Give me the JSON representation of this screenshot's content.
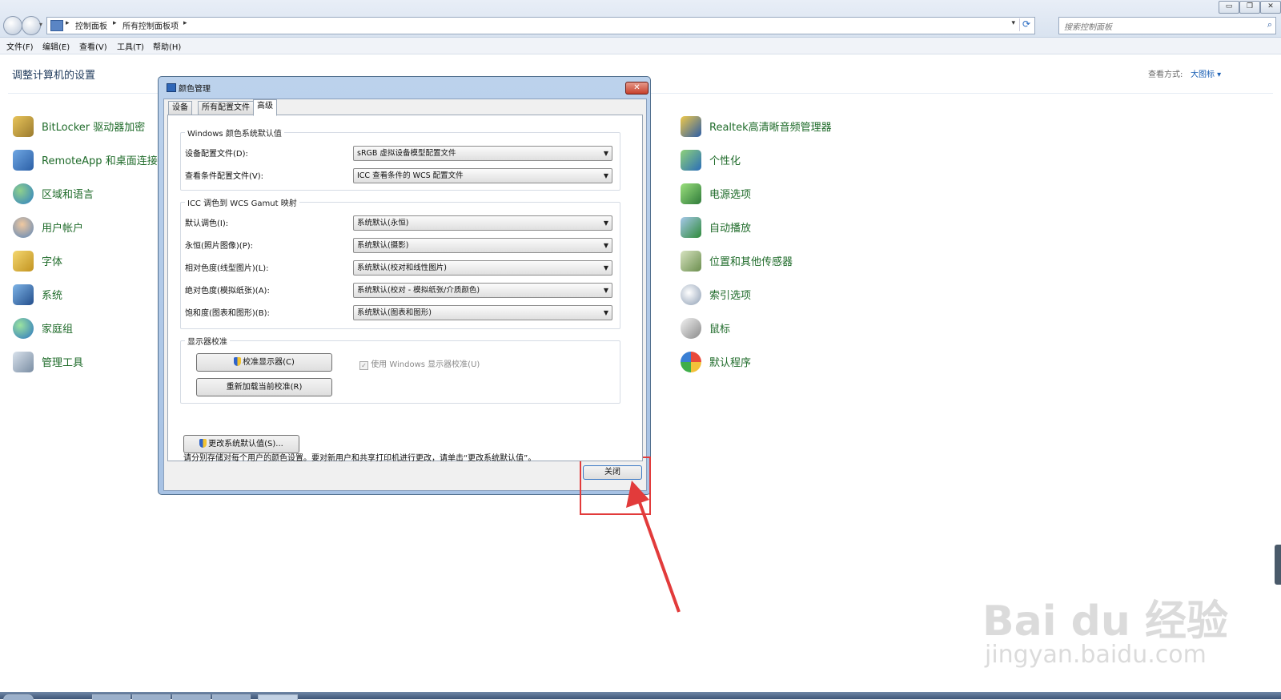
{
  "window": {
    "breadcrumbs": [
      "控制面板",
      "所有控制面板项"
    ],
    "search_placeholder": "搜索控制面板",
    "controls": [
      "▭",
      "❐",
      "✕"
    ]
  },
  "menu": [
    "文件(F)",
    "编辑(E)",
    "查看(V)",
    "工具(T)",
    "帮助(H)"
  ],
  "control_panel": {
    "title": "调整计算机的设置",
    "view_label": "查看方式:",
    "view_value": "大图标 ▾",
    "left_items": [
      {
        "label": "BitLocker 驱动器加密",
        "icon": "bitlocker-key-icon"
      },
      {
        "label": "RemoteApp 和桌面连接",
        "icon": "remoteapp-icon"
      },
      {
        "label": "区域和语言",
        "icon": "region-globe-icon"
      },
      {
        "label": "用户帐户",
        "icon": "user-accounts-icon"
      },
      {
        "label": "字体",
        "icon": "fonts-icon"
      },
      {
        "label": "系统",
        "icon": "system-computer-icon"
      },
      {
        "label": "家庭组",
        "icon": "homegroup-icon"
      },
      {
        "label": "管理工具",
        "icon": "admin-tools-icon"
      }
    ],
    "right_items": [
      {
        "label": "Realtek高清晰音频管理器",
        "icon": "realtek-audio-icon"
      },
      {
        "label": "个性化",
        "icon": "personalization-icon"
      },
      {
        "label": "电源选项",
        "icon": "power-options-icon"
      },
      {
        "label": "自动播放",
        "icon": "autoplay-icon"
      },
      {
        "label": "位置和其他传感器",
        "icon": "location-sensors-icon"
      },
      {
        "label": "索引选项",
        "icon": "indexing-options-icon"
      },
      {
        "label": "鼠标",
        "icon": "mouse-icon"
      },
      {
        "label": "默认程序",
        "icon": "default-programs-icon"
      }
    ]
  },
  "dialog": {
    "title": "颜色管理",
    "tabs": [
      "设备",
      "所有配置文件",
      "高级"
    ],
    "active_tab": "高级",
    "windows_defaults": {
      "legend": "Windows 颜色系统默认值",
      "device_profile_label": "设备配置文件(D):",
      "device_profile_value": "sRGB 虚拟设备模型配置文件",
      "viewing_conditions_label": "查看条件配置文件(V):",
      "viewing_conditions_value": "ICC 查看条件的 WCS 配置文件"
    },
    "gamut": {
      "legend": "ICC 调色到 WCS Gamut 映射",
      "rows": [
        {
          "label": "默认调色(I):",
          "value": "系统默认(永恒)"
        },
        {
          "label": "永恒(照片图像)(P):",
          "value": "系统默认(摄影)"
        },
        {
          "label": "相对色度(线型图片)(L):",
          "value": "系统默认(校对和线性图片)"
        },
        {
          "label": "绝对色度(模拟纸张)(A):",
          "value": "系统默认(校对 - 模拟纸张/介质颜色)"
        },
        {
          "label": "饱和度(图表和图形)(B):",
          "value": "系统默认(图表和图形)"
        }
      ]
    },
    "calibration": {
      "legend": "显示器校准",
      "calibrate_button": "校准显示器(C)",
      "reload_button": "重新加载当前校准(R)",
      "use_windows_checkbox": "使用 Windows 显示器校准(U)"
    },
    "note": "请分别存储对每个用户的颜色设置。要对新用户和共享打印机进行更改，请单击“更改系统默认值”。",
    "change_defaults_button": "更改系统默认值(S)...",
    "close_button": "关闭"
  },
  "watermark": {
    "main": "Bai du 经验",
    "sub": "jingyan.baidu.com"
  },
  "colors": {
    "annotation": "#e23b3b",
    "link_green": "#1f6b2a",
    "title_blue": "#1e395b"
  }
}
